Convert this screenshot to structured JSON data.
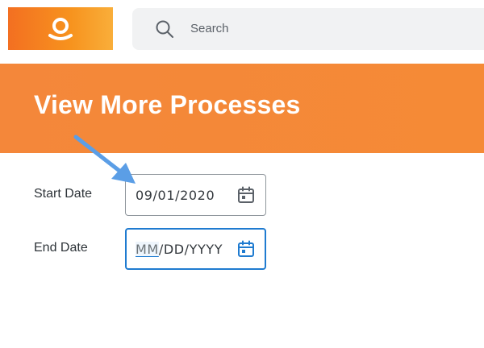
{
  "header": {
    "logo_icon": "workday-logo-icon",
    "search": {
      "icon": "search-icon",
      "placeholder": "Search"
    }
  },
  "page": {
    "title": "View More Processes"
  },
  "form": {
    "start_date": {
      "label": "Start Date",
      "value": "09/01/2020",
      "icon": "calendar-icon"
    },
    "end_date": {
      "label": "End Date",
      "placeholder_segments": {
        "month": "MM",
        "sep1": "/",
        "day": "DD",
        "sep2": "/",
        "year": "YYYY"
      },
      "focused": true,
      "icon": "calendar-icon"
    }
  },
  "annotation": {
    "icon": "pointer-arrow-icon",
    "color": "#4a90e2"
  },
  "colors": {
    "brand_orange": "#f58a36",
    "focus_blue": "#1f7bd0"
  }
}
